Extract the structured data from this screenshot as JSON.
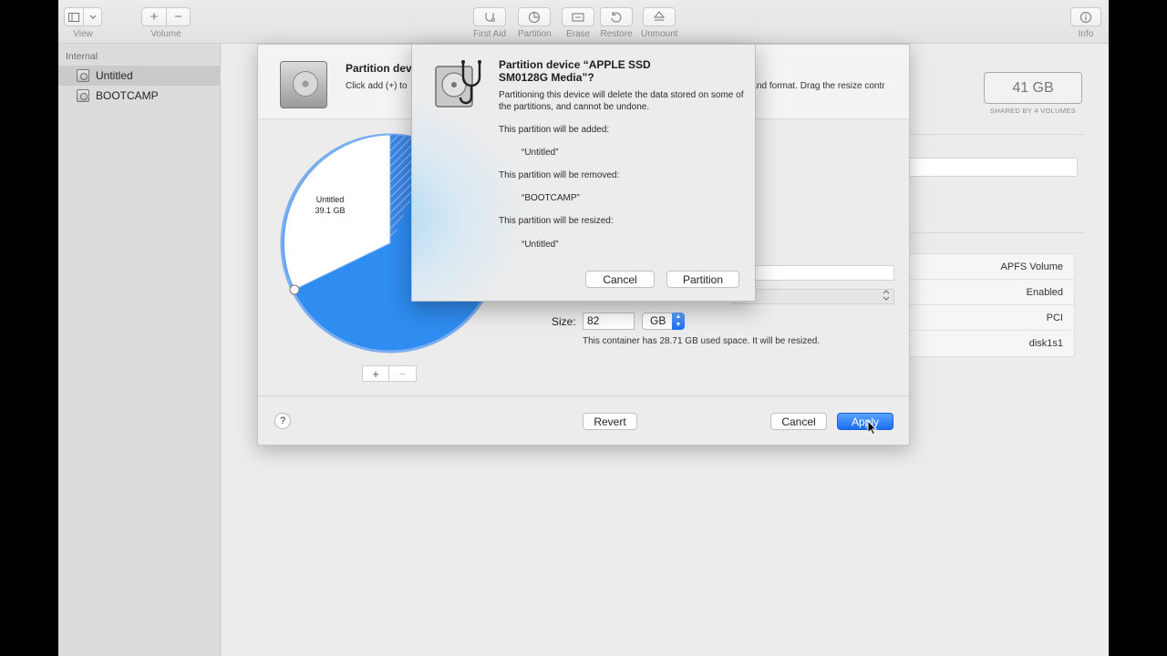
{
  "toolbar": {
    "view_label": "View",
    "volume_label": "Volume",
    "volume_add": "+",
    "volume_remove": "−",
    "first_aid_label": "First Aid",
    "partition_label": "Partition",
    "erase_label": "Erase",
    "restore_label": "Restore",
    "unmount_label": "Unmount",
    "info_label": "Info"
  },
  "sidebar": {
    "header": "Internal",
    "items": [
      {
        "label": "Untitled",
        "selected": true
      },
      {
        "label": "BOOTCAMP",
        "selected": false
      }
    ]
  },
  "main": {
    "capacity": "41 GB",
    "capacity_sub": "SHARED BY 4 VOLUMES",
    "info_rows": [
      "APFS Volume",
      "Enabled",
      "PCI",
      "disk1s1"
    ]
  },
  "sheet": {
    "title": "Partition dev",
    "description": "Click add (+) to                                                                                                                   ge the name and format. Drag the resize contr",
    "pie_label_name": "Untitled",
    "pie_label_size": "39.1 GB",
    "size_label": "Size:",
    "size_value": "82",
    "unit_value": "GB",
    "resize_note": "This container has 28.71 GB used space. It will be resized.",
    "add_label": "+",
    "remove_label": "−",
    "help_label": "?",
    "revert_label": "Revert",
    "cancel_label": "Cancel",
    "apply_label": "Apply"
  },
  "alert": {
    "title": "Partition device “APPLE SSD SM0128G Media”?",
    "message": "Partitioning this device will delete the data stored on some of the partitions, and cannot be undone.",
    "added_heading": "This partition will be added:",
    "added_name": "“Untitled”",
    "removed_heading": "This partition will be removed:",
    "removed_name": "“BOOTCAMP”",
    "resized_heading": "This partition will be resized:",
    "resized_name": "“Untitled”",
    "cancel_label": "Cancel",
    "partition_label": "Partition"
  },
  "colors": {
    "accent": "#1c6ef2",
    "pie_blue": "#2f8cf0",
    "pie_stripe": "#5a9be0"
  }
}
